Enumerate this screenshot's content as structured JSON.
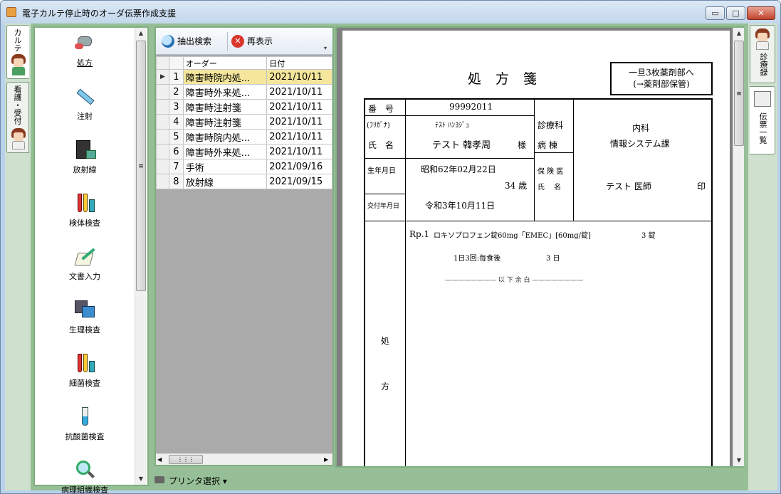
{
  "window": {
    "title": "電子カルテ停止時のオーダ伝票作成支援",
    "min_label": "▭",
    "max_label": "□",
    "close_label": "✕"
  },
  "left_tabs": [
    {
      "label": "カルテ"
    },
    {
      "label": "看護・受付"
    }
  ],
  "sidebar": {
    "items": [
      {
        "label": "処方",
        "icon": "pill-bottle-icon"
      },
      {
        "label": "注射",
        "icon": "syringe-icon"
      },
      {
        "label": "放射線",
        "icon": "xray-icon"
      },
      {
        "label": "検体検査",
        "icon": "test-tube-icon"
      },
      {
        "label": "文書入力",
        "icon": "pen-paper-icon"
      },
      {
        "label": "生理検査",
        "icon": "ecg-monitor-icon"
      },
      {
        "label": "細菌検査",
        "icon": "culture-tube-icon"
      },
      {
        "label": "抗酸菌検査",
        "icon": "vial-icon"
      },
      {
        "label": "病理組織検査",
        "icon": "magnifier-icon"
      }
    ]
  },
  "toolbar": {
    "search_label": "抽出検索",
    "refresh_label": "再表示"
  },
  "order_list": {
    "headers": {
      "order": "オーダー",
      "date": "日付"
    },
    "rows": [
      {
        "no": "1",
        "order": "障害時院内処...",
        "date": "2021/10/11"
      },
      {
        "no": "2",
        "order": "障害時外来処...",
        "date": "2021/10/11"
      },
      {
        "no": "3",
        "order": "障害時注射箋",
        "date": "2021/10/11"
      },
      {
        "no": "4",
        "order": "障害時注射箋",
        "date": "2021/10/11"
      },
      {
        "no": "5",
        "order": "障害時院内処...",
        "date": "2021/10/11"
      },
      {
        "no": "6",
        "order": "障害時外来処...",
        "date": "2021/10/11"
      },
      {
        "no": "7",
        "order": "手術",
        "date": "2021/09/16"
      },
      {
        "no": "8",
        "order": "放射線",
        "date": "2021/09/15"
      }
    ],
    "selected_row": 1
  },
  "status_bar": {
    "printer_label": "プリンタ選択"
  },
  "right_tabs": [
    {
      "label": "診療録"
    },
    {
      "label": "伝票一覧"
    }
  ],
  "document": {
    "title": "処方箋",
    "note_line1": "一旦3枚薬剤部へ",
    "note_line2": "(→薬剤部保管)",
    "number_label": "番　号",
    "number_value": "99992011",
    "furigana_label": "(ﾌﾘｶﾞﾅ)",
    "furigana_value": "ﾃｽﾄ ﾊﾝﾖｼﾞｭ",
    "name_label": "氏　名",
    "name_value": "テスト 韓孝周",
    "honorific": "様",
    "dept_label": "診療科",
    "ward_label": "病 棟",
    "dept_value": "内科",
    "ward_value": "情報システム課",
    "birth_label": "生年月日",
    "birth_value": "昭和62年02月22日",
    "age_value": "34 歳",
    "doctor_label1": "保 険 医",
    "doctor_label2": "氏　 名",
    "doctor_value": "テスト 医師",
    "seal": "印",
    "issue_label": "交付年月日",
    "issue_value": "令和3年10月11日",
    "rx_label1": "処",
    "rx_label2": "方",
    "rp_no": "Rp.1",
    "rp_drug": "ロキソプロフェン錠60mg「EMEC」[60mg/錠]",
    "rp_qty": "3 錠",
    "rp_usage": "1日3回:毎食後",
    "rp_days": "3 日",
    "end_mark": "———————— 以 下 余 白 ————————"
  }
}
